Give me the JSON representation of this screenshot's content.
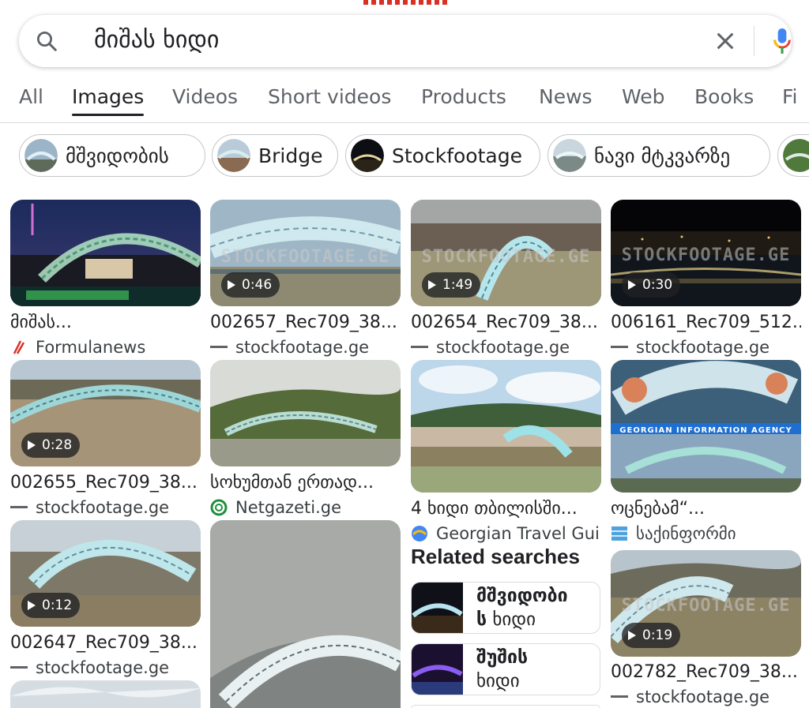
{
  "search": {
    "query": "მიშას ხიდი"
  },
  "tabs": [
    {
      "label": "All",
      "active": false
    },
    {
      "label": "Images",
      "active": true
    },
    {
      "label": "Videos",
      "active": false
    },
    {
      "label": "Short videos",
      "active": false
    },
    {
      "label": "Products",
      "active": false
    },
    {
      "label": "News",
      "active": false
    },
    {
      "label": "Web",
      "active": false
    },
    {
      "label": "Books",
      "active": false
    },
    {
      "label": "Fi",
      "active": false
    }
  ],
  "chips": [
    {
      "label": "მშვიდობის"
    },
    {
      "label": "Bridge"
    },
    {
      "label": "Stockfootage"
    },
    {
      "label": "ნავი მტკვარზე"
    }
  ],
  "results": [
    {
      "title": "მიშას...",
      "source": "Formulanews",
      "duration": "",
      "watermark": ""
    },
    {
      "title": "002657_Rec709_38...",
      "source": "stockfootage.ge",
      "duration": "0:46",
      "watermark": "STOCKFOOTAGE.GE"
    },
    {
      "title": "002654_Rec709_38...",
      "source": "stockfootage.ge",
      "duration": "1:49",
      "watermark": "STOCKFOOTAGE.GE"
    },
    {
      "title": "006161_Rec709_512...",
      "source": "stockfootage.ge",
      "duration": "0:30",
      "watermark": "STOCKFOOTAGE.GE"
    },
    {
      "title": "002655_Rec709_38...",
      "source": "stockfootage.ge",
      "duration": "0:28",
      "watermark": ""
    },
    {
      "title": "სოხუმთან ერთად...",
      "source": "Netgazeti.ge",
      "duration": "",
      "watermark": ""
    },
    {
      "title": "4 ხიდი თბილისში...",
      "source": "Georgian Travel Gui",
      "duration": "",
      "watermark": ""
    },
    {
      "title": "ოცნებამ“...",
      "source": "საქინფორმი",
      "duration": "",
      "watermark": "GEORGIAN INFORMATION AGENCY"
    },
    {
      "title": "002647_Rec709_38...",
      "source": "stockfootage.ge",
      "duration": "0:12",
      "watermark": ""
    },
    {
      "title": "",
      "source": "",
      "duration": "",
      "watermark": ""
    },
    {
      "title": "002782_Rec709_38...",
      "source": "stockfootage.ge",
      "duration": "0:19",
      "watermark": "STOCKFOOTAGE.GE"
    }
  ],
  "related": {
    "heading": "Related searches",
    "items": [
      {
        "bold": "მშვიდობი",
        "line2_bold": "ს",
        "line2_rest": " ხიდი"
      },
      {
        "bold": "შუშის",
        "line2_bold": "",
        "line2_rest": "ხიდი"
      }
    ]
  },
  "colors": {
    "accent_mic_blue": "#4285f4",
    "accent_mic_red": "#ea4335",
    "accent_mic_yellow": "#fbbc04",
    "accent_mic_green": "#34a853",
    "formulanews_red": "#d93025",
    "netgazeti_green": "#1e8e3e"
  }
}
